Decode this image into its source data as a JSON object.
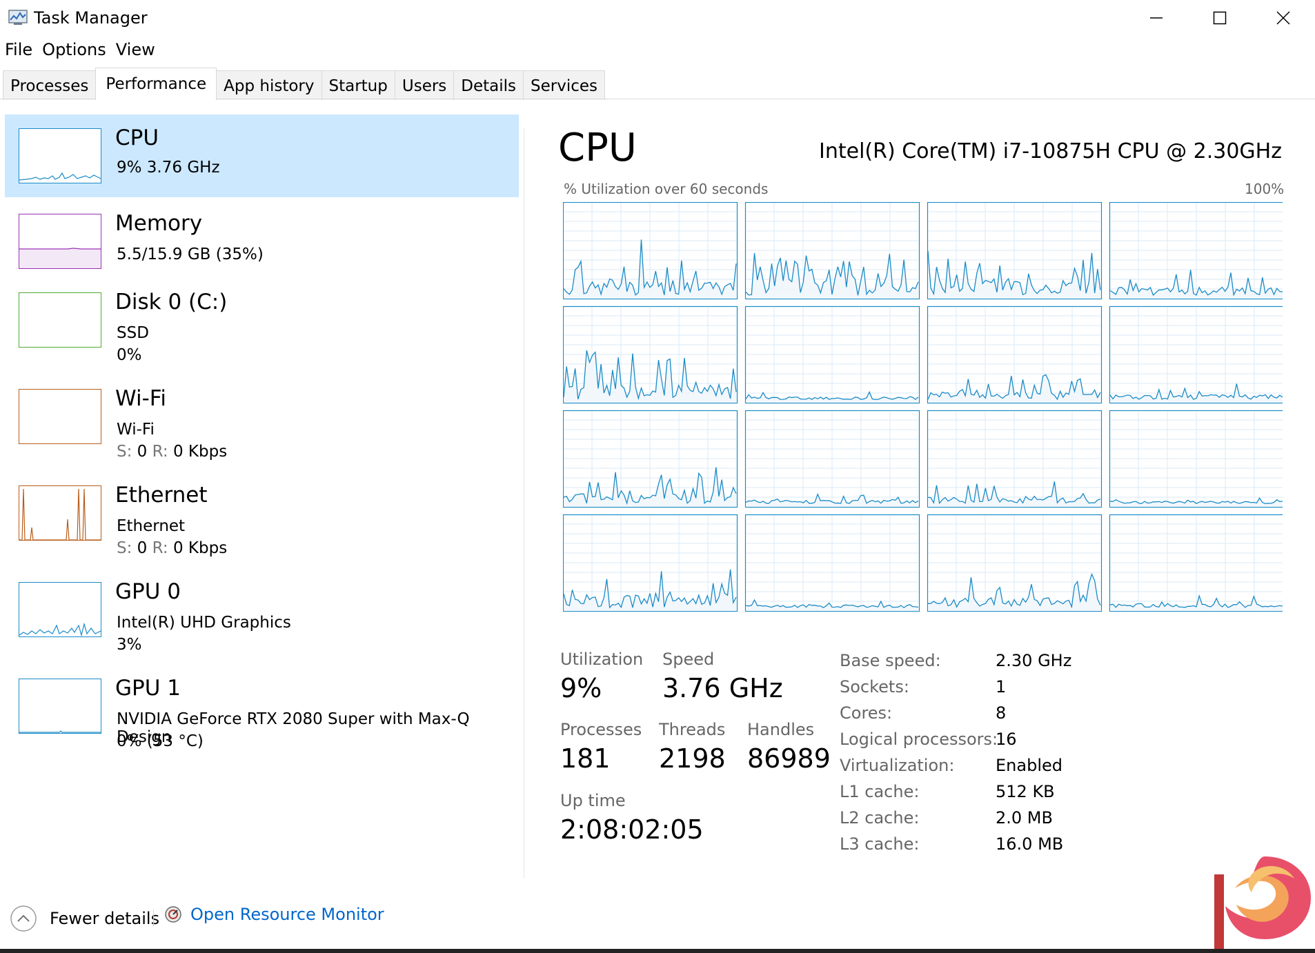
{
  "window": {
    "title": "Task Manager"
  },
  "menu": [
    "File",
    "Options",
    "View"
  ],
  "tabs": [
    "Processes",
    "Performance",
    "App history",
    "Startup",
    "Users",
    "Details",
    "Services"
  ],
  "active_tab": "Performance",
  "sidebar": {
    "items": [
      {
        "title": "CPU",
        "line1": "9%  3.76 GHz",
        "color": "#1a8bc7",
        "selected": true
      },
      {
        "title": "Memory",
        "line1": "5.5/15.9 GB (35%)",
        "color": "#9a31b5"
      },
      {
        "title": "Disk 0 (C:)",
        "line1": "SSD",
        "line2": "0%",
        "color": "#4ea831"
      },
      {
        "title": "Wi-Fi",
        "line1": "Wi-Fi",
        "s_label": "S:",
        "s_value": "0",
        "r_label": "R:",
        "r_value": "0 Kbps",
        "color": "#b85d1a"
      },
      {
        "title": "Ethernet",
        "line1": "Ethernet",
        "s_label": "S:",
        "s_value": "0",
        "r_label": "R:",
        "r_value": "0 Kbps",
        "color": "#b85d1a"
      },
      {
        "title": "GPU 0",
        "line1": "Intel(R) UHD Graphics",
        "line2": "3%",
        "color": "#1a8bc7"
      },
      {
        "title": "GPU 1",
        "line1": "NVIDIA GeForce RTX 2080 Super with Max-Q Design",
        "line2": "0% (53 °C)",
        "color": "#1a8bc7"
      }
    ]
  },
  "main": {
    "title": "CPU",
    "cpu_name": "Intel(R) Core(TM) i7-10875H CPU @ 2.30GHz",
    "util_label": "% Utilization over 60 seconds",
    "util_max": "100%",
    "graph_color": "#1a8bc7",
    "graph_grid_color": "#d9eaf7",
    "graph_fill_color": "#f1f6fb",
    "logical_processor_count": 16
  },
  "stats": {
    "utilization_label": "Utilization",
    "utilization": "9%",
    "speed_label": "Speed",
    "speed": "3.76 GHz",
    "processes_label": "Processes",
    "processes": "181",
    "threads_label": "Threads",
    "threads": "2198",
    "handles_label": "Handles",
    "handles": "86989",
    "uptime_label": "Up time",
    "uptime": "2:08:02:05"
  },
  "specs": [
    {
      "key": "Base speed:",
      "value": "2.30 GHz"
    },
    {
      "key": "Sockets:",
      "value": "1"
    },
    {
      "key": "Cores:",
      "value": "8"
    },
    {
      "key": "Logical processors:",
      "value": "16"
    },
    {
      "key": "Virtualization:",
      "value": "Enabled"
    },
    {
      "key": "L1 cache:",
      "value": "512 KB"
    },
    {
      "key": "L2 cache:",
      "value": "2.0 MB"
    },
    {
      "key": "L3 cache:",
      "value": "16.0 MB"
    }
  ],
  "footer": {
    "fewer_details": "Fewer details",
    "open_resource_monitor": "Open Resource Monitor"
  },
  "icons": {
    "app": "task-manager-icon",
    "minimize": "minimize-icon",
    "maximize": "maximize-icon",
    "close": "close-icon",
    "fewer": "chevron-up-circle-icon",
    "resmon": "resource-monitor-icon"
  }
}
